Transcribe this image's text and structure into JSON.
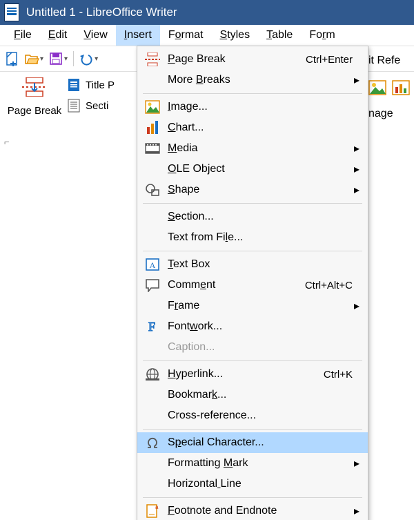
{
  "window": {
    "title": "Untitled 1 - LibreOffice Writer"
  },
  "menubar": {
    "items": [
      {
        "label": "File",
        "mnemonic_index": 0
      },
      {
        "label": "Edit",
        "mnemonic_index": 0
      },
      {
        "label": "View",
        "mnemonic_index": 0
      },
      {
        "label": "Insert",
        "mnemonic_index": 0,
        "active": true
      },
      {
        "label": "Format",
        "mnemonic_index": 1
      },
      {
        "label": "Styles",
        "mnemonic_index": 0
      },
      {
        "label": "Table",
        "mnemonic_index": 0
      },
      {
        "label": "Form",
        "mnemonic_index": 2
      }
    ]
  },
  "ribbon": {
    "big_button": {
      "label": "Page Break"
    },
    "title_page": "Title P",
    "section": "Secti",
    "right": {
      "ref_label": "it Refe",
      "image_label": "nage"
    }
  },
  "insert_menu": {
    "items": [
      {
        "icon": "page-break",
        "label": "Page Break",
        "mnemonic_index": 0,
        "accel": "Ctrl+Enter"
      },
      {
        "icon": "",
        "label": "More Breaks",
        "mnemonic_index": 5,
        "submenu": true
      },
      {
        "sep": true
      },
      {
        "icon": "image",
        "label": "Image...",
        "mnemonic_index": 0
      },
      {
        "icon": "chart",
        "label": "Chart...",
        "mnemonic_index": 0
      },
      {
        "icon": "media",
        "label": "Media",
        "mnemonic_index": 0,
        "submenu": true
      },
      {
        "icon": "",
        "label": "OLE Object",
        "mnemonic_index": 0,
        "submenu": true
      },
      {
        "icon": "shape",
        "label": "Shape",
        "mnemonic_index": 0,
        "submenu": true
      },
      {
        "sep": true
      },
      {
        "icon": "",
        "label": "Section...",
        "mnemonic_index": 0
      },
      {
        "icon": "",
        "label": "Text from File...",
        "mnemonic_index": 12
      },
      {
        "sep": true
      },
      {
        "icon": "textbox",
        "label": "Text Box",
        "mnemonic_index": 0
      },
      {
        "icon": "comment",
        "label": "Comment",
        "mnemonic_index": 4,
        "accel": "Ctrl+Alt+C"
      },
      {
        "icon": "",
        "label": "Frame",
        "mnemonic_index": 1,
        "submenu": true
      },
      {
        "icon": "fontwork",
        "label": "Fontwork...",
        "mnemonic_index": 4
      },
      {
        "icon": "",
        "label": "Caption...",
        "disabled": true
      },
      {
        "sep": true
      },
      {
        "icon": "hyperlink",
        "label": "Hyperlink...",
        "mnemonic_index": 0,
        "accel": "Ctrl+K"
      },
      {
        "icon": "",
        "label": "Bookmark...",
        "mnemonic_index": 7
      },
      {
        "icon": "",
        "label": "Cross-reference..."
      },
      {
        "sep": true
      },
      {
        "icon": "omega",
        "label": "Special Character...",
        "mnemonic_index": 1,
        "highlight": true
      },
      {
        "icon": "",
        "label": "Formatting Mark",
        "mnemonic_index": 11,
        "submenu": true
      },
      {
        "icon": "",
        "label": "Horizontal Line",
        "mnemonic_index": 10
      },
      {
        "sep": true
      },
      {
        "icon": "footnote",
        "label": "Footnote and Endnote",
        "mnemonic_index": 0,
        "submenu": true
      }
    ]
  }
}
